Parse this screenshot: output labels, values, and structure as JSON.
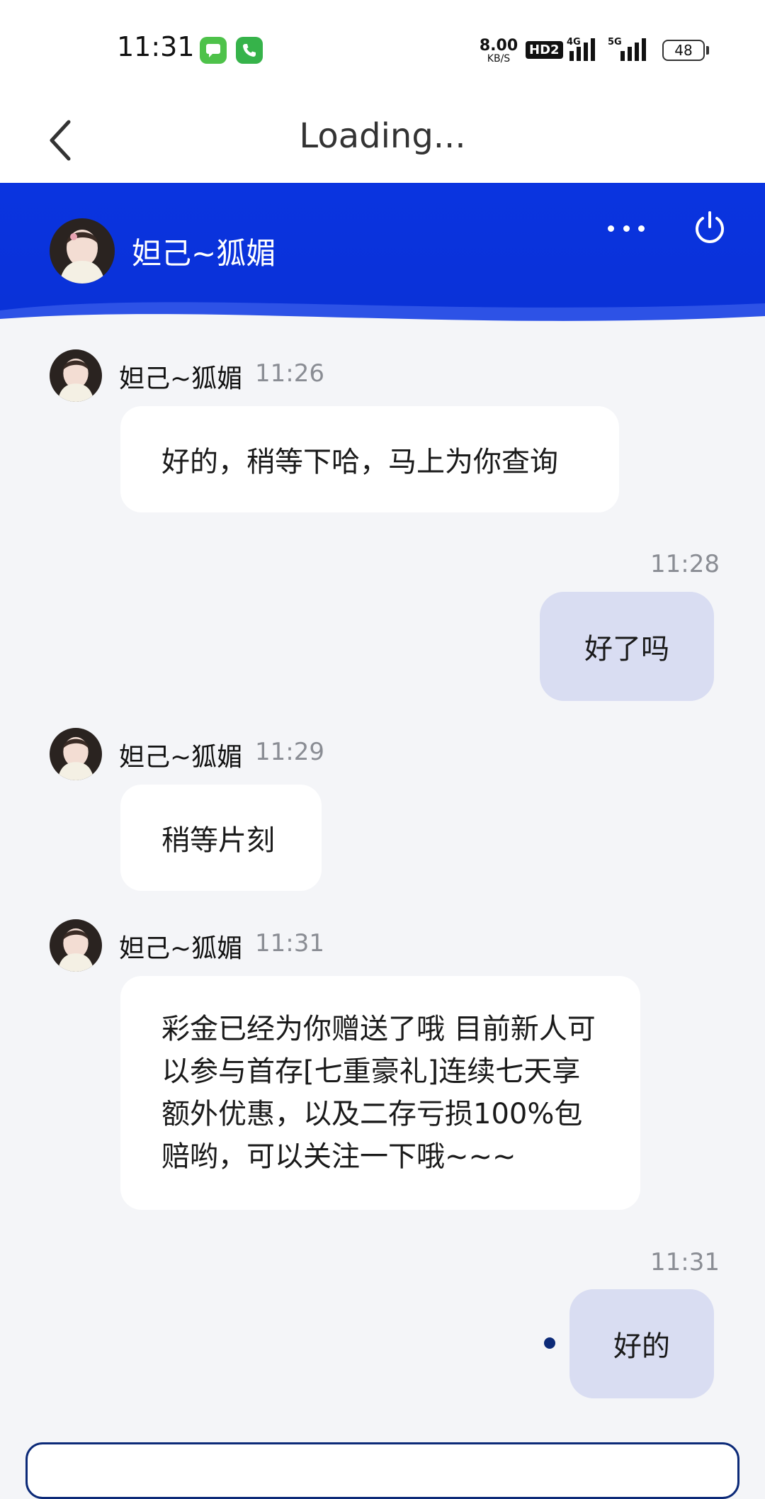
{
  "status_bar": {
    "time": "11:31",
    "net_speed_value": "8.00",
    "net_speed_unit": "KB/S",
    "hd_label": "HD2",
    "sig1_label": "4G",
    "sig2_label": "5G",
    "battery": "48",
    "icons": [
      "messages-app-icon",
      "phone-app-icon",
      "signal-icon",
      "battery-icon"
    ]
  },
  "header": {
    "title": "Loading...",
    "back_icon": "chevron-left-icon"
  },
  "agent": {
    "name": "妲己~狐媚",
    "more_icon": "more-dots-icon",
    "power_icon": "power-icon"
  },
  "messages": [
    {
      "from": "agent",
      "sender": "妲己~狐媚",
      "time": "11:26",
      "text": "好的，稍等下哈，马上为你查询"
    },
    {
      "from": "user",
      "time": "11:28",
      "text": "好了吗"
    },
    {
      "from": "agent",
      "sender": "妲己~狐媚",
      "time": "11:29",
      "text": "稍等片刻"
    },
    {
      "from": "agent",
      "sender": "妲己~狐媚",
      "time": "11:31",
      "text": "彩金已经为你赠送了哦 目前新人可以参与首存[七重豪礼]连续七天享额外优惠，以及二存亏损100%包赔哟，可以关注一下哦~~~"
    },
    {
      "from": "user",
      "time": "11:31",
      "text": "好的"
    }
  ],
  "colors": {
    "banner": "#0a34e0",
    "user_bubble": "#d9ddf2",
    "agent_bubble": "#ffffff",
    "chat_bg": "#f4f5f8",
    "accent_dark": "#0c2a78"
  }
}
